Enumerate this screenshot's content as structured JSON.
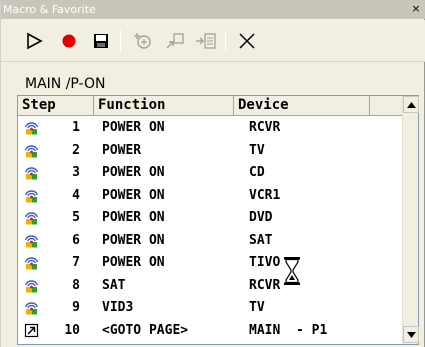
{
  "window": {
    "title": "Macro & Favorite",
    "close_glyph": "×"
  },
  "toolbar": {
    "buttons": [
      {
        "name": "play-icon",
        "color": "#000000"
      },
      {
        "name": "record-icon",
        "color": "#e00000"
      },
      {
        "name": "save-icon",
        "color": "#000000"
      },
      {
        "name": "insert-step-icon",
        "color": "#a0a0a0"
      },
      {
        "name": "jump-icon",
        "color": "#a0a0a0"
      },
      {
        "name": "insert-macro-icon",
        "color": "#a0a0a0"
      },
      {
        "name": "delete-icon",
        "color": "#000000"
      }
    ]
  },
  "path": "MAIN /P-ON",
  "table": {
    "columns": [
      "Step",
      "Function",
      "Device"
    ],
    "rows": [
      {
        "step": "1",
        "function": "POWER ON",
        "device": "RCVR",
        "icon": "remote-signal-icon"
      },
      {
        "step": "2",
        "function": "POWER",
        "device": "TV",
        "icon": "remote-signal-icon"
      },
      {
        "step": "3",
        "function": "POWER ON",
        "device": "CD",
        "icon": "remote-signal-icon"
      },
      {
        "step": "4",
        "function": "POWER ON",
        "device": "VCR1",
        "icon": "remote-signal-icon"
      },
      {
        "step": "5",
        "function": "POWER ON",
        "device": "DVD",
        "icon": "remote-signal-icon"
      },
      {
        "step": "6",
        "function": "POWER ON",
        "device": "SAT",
        "icon": "remote-signal-icon"
      },
      {
        "step": "7",
        "function": "POWER ON",
        "device": "TIVO",
        "icon": "remote-signal-icon"
      },
      {
        "step": "8",
        "function": "SAT",
        "device": "RCVR",
        "icon": "remote-signal-icon"
      },
      {
        "step": "9",
        "function": "VID3",
        "device": "TV",
        "icon": "remote-signal-icon"
      },
      {
        "step": "10",
        "function": "<GOTO PAGE>",
        "device": "MAIN  - P1",
        "icon": "goto-page-icon"
      }
    ]
  },
  "cursor": "hourglass-icon"
}
